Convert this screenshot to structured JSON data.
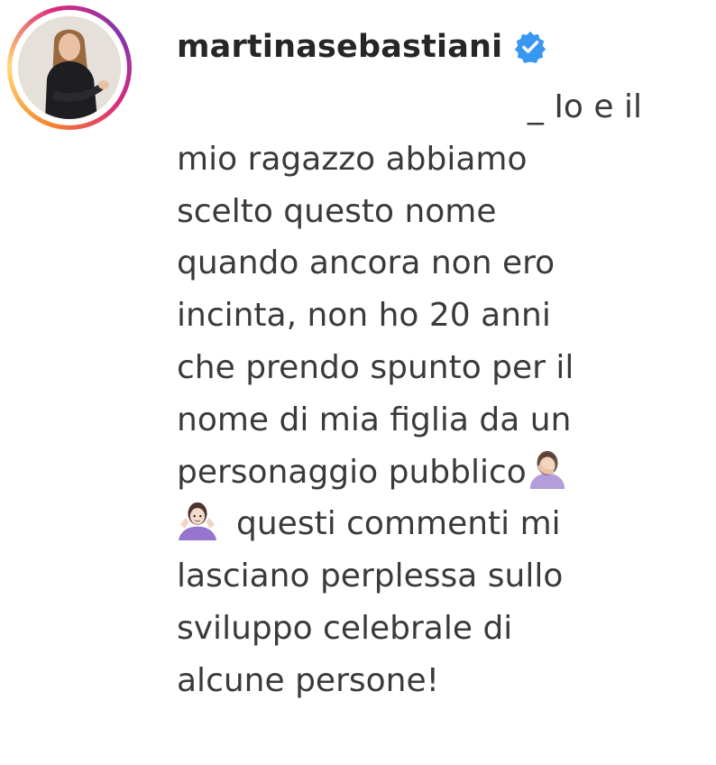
{
  "post_comment": {
    "username": "martinasebastiani",
    "verified_icon": "verified-badge-icon",
    "verified_color": "#3897f0",
    "avatar": {
      "ring_colors": [
        "#f58529",
        "#dd2a7b",
        "#8134af"
      ]
    },
    "lines": [
      "_ Io e il",
      "mio ragazzo abbiamo",
      "scelto questo nome",
      "quando ancora non ero",
      "incinta, non ho 20 anni",
      "che prendo spunto per il",
      "nome di mia figlia da un",
      "personaggio pubblico",
      "questi commenti mi",
      "lasciano perplessa sullo",
      "sviluppo celebrale di",
      "alcune persone!"
    ],
    "emojis": {
      "facepalm": "woman-facepalming-emoji",
      "shrug": "woman-shrugging-emoji"
    }
  }
}
